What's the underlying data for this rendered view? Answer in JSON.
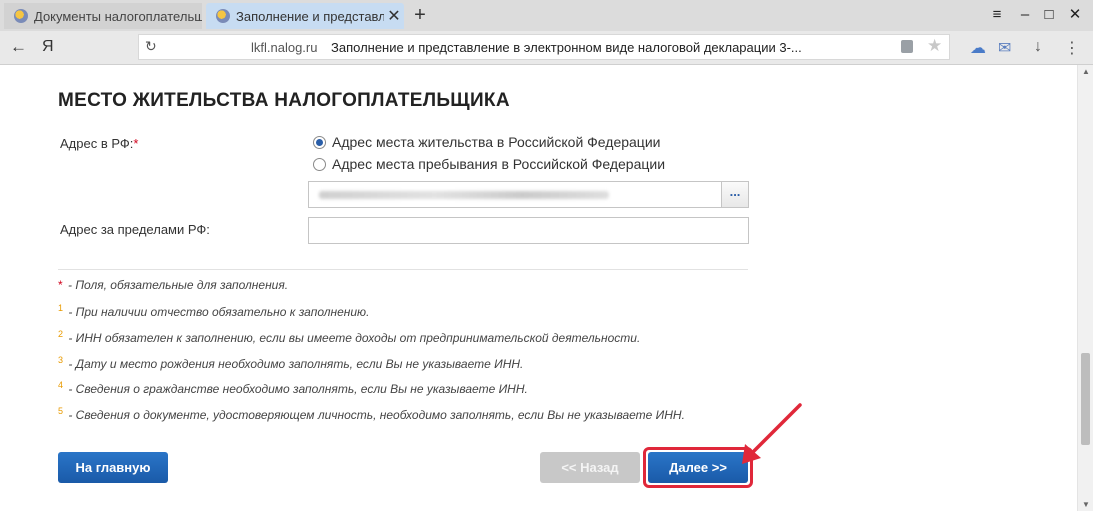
{
  "browser": {
    "tabs": [
      {
        "label": "Документы налогоплательщ",
        "active": false
      },
      {
        "label": "Заполнение и представл",
        "active": true
      }
    ],
    "new_tab": "+",
    "window_controls": {
      "menu": "≡",
      "minimize": "–",
      "maximize": "□",
      "close": "✕"
    },
    "back": "←",
    "yandex": "Я",
    "address": {
      "domain": "lkfl.nalog.ru",
      "page_title": "Заполнение и представление в электронном виде налоговой декларации 3-..."
    }
  },
  "page": {
    "heading": "МЕСТО ЖИТЕЛЬСТВА НАЛОГОПЛАТЕЛЬЩИКА",
    "address_rf_label": "Адрес в РФ:",
    "required_mark": "*",
    "radio_options": [
      {
        "label": "Адрес места жительства в Российской Федерации",
        "checked": true
      },
      {
        "label": "Адрес места пребывания в Российской Федерации",
        "checked": false
      }
    ],
    "address_picker_button": "...",
    "abroad_label": "Адрес за пределами РФ:",
    "abroad_value": "",
    "notes": [
      {
        "mark": "*",
        "text": " - Поля, обязательные для заполнения."
      },
      {
        "mark": "1",
        "text": " - При наличии отчество обязательно к заполнению."
      },
      {
        "mark": "2",
        "text": " - ИНН обязателен к заполнению, если вы имеете доходы от предпринимательской деятельности."
      },
      {
        "mark": "3",
        "text": " - Дату и место рождения необходимо заполнять, если Вы не указываете ИНН."
      },
      {
        "mark": "4",
        "text": " - Сведения о гражданстве необходимо заполнять, если Вы не указываете ИНН."
      },
      {
        "mark": "5",
        "text": " - Сведения о документе, удостоверяющем личность, необходимо заполнять, если Вы не указываете ИНН."
      }
    ],
    "buttons": {
      "home": "На главную",
      "back": "<< Назад",
      "next": "Далее >>"
    }
  },
  "colors": {
    "primary_button": "#1a5aa8",
    "disabled_button": "#c8c8c8",
    "highlight": "#e0283a",
    "required": "#d0021b",
    "footnote_mark": "#e89a00"
  }
}
